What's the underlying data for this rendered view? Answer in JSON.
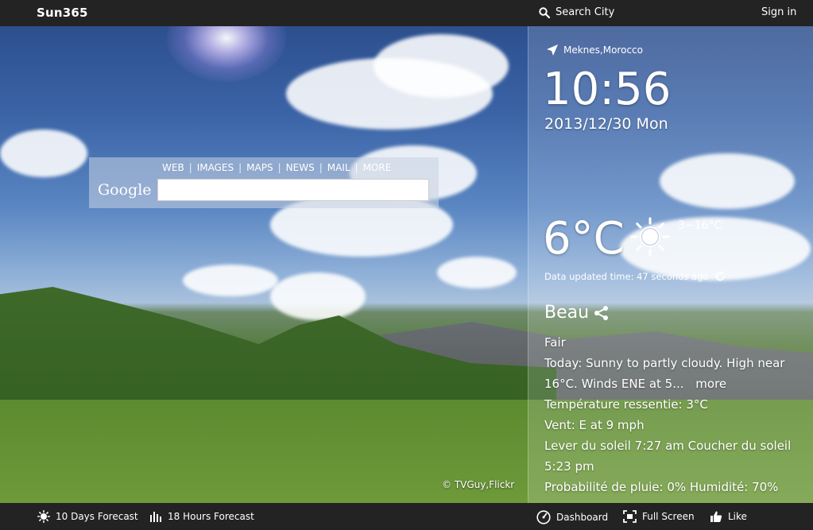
{
  "topbar": {
    "brand": "Sun365",
    "search_label": "Search City",
    "signin_label": "Sign in"
  },
  "search_box": {
    "logo": "Google",
    "nav": [
      "WEB",
      "IMAGES",
      "MAPS",
      "NEWS",
      "MAIL",
      "MORE"
    ],
    "query": ""
  },
  "photo_credit": "© TVGuy,Flickr",
  "weather": {
    "location": "Meknes,Morocco",
    "time": "10:56",
    "date": "2013/12/30 Mon",
    "temperature": "6°C",
    "range": "3~16°C",
    "updated": "Data updated time: 47 seconds ago",
    "condition_title": "Beau",
    "condition": "Fair",
    "forecast_text": "Today: Sunny to partly cloudy. High near 16°C. Winds ENE at 5...",
    "more_label": "more",
    "feels_like": "Température ressentie: 3°C",
    "wind": "Vent: E at 9 mph",
    "sun_times": "Lever du soleil 7:27 am Coucher du soleil 5:23 pm",
    "rain_humidity": "Probabilité de pluie: 0% Humidité: 70%"
  },
  "bottombar": {
    "days_forecast": "10 Days Forecast",
    "hours_forecast": "18 Hours Forecast",
    "dashboard": "Dashboard",
    "fullscreen": "Full Screen",
    "like": "Like"
  },
  "icons": {
    "search": "search-icon",
    "location": "location-arrow-icon",
    "sun": "sun-icon",
    "refresh": "refresh-icon",
    "share": "share-icon",
    "bars": "bar-chart-icon",
    "dashboard": "gauge-icon",
    "fullscreen": "fullscreen-icon",
    "like": "thumbs-up-icon"
  }
}
